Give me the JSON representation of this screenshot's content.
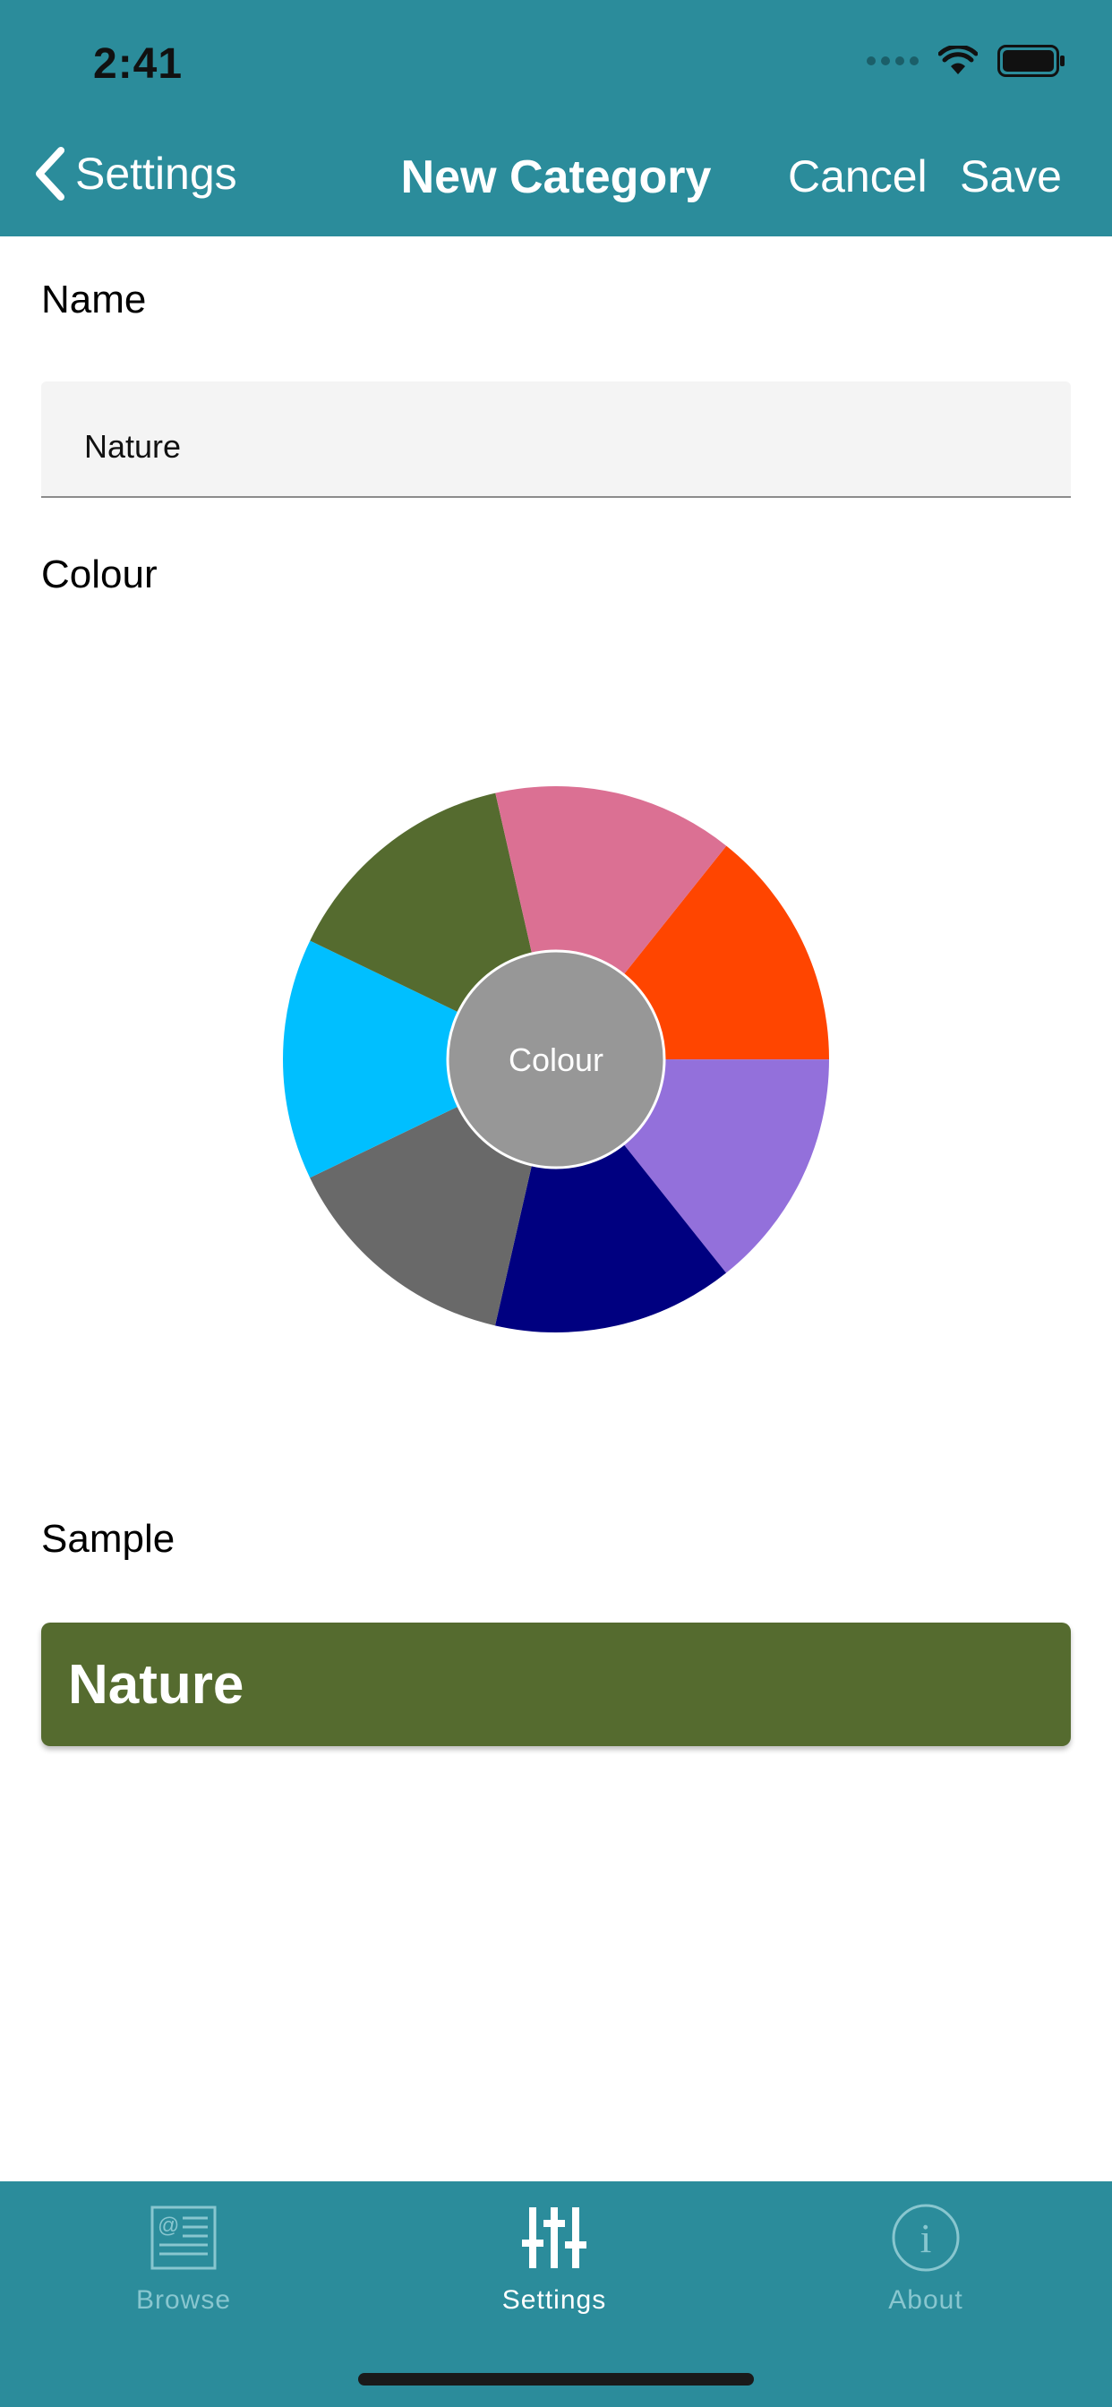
{
  "status_bar": {
    "time": "2:41"
  },
  "nav": {
    "back_label": "Settings",
    "title": "New Category",
    "cancel_label": "Cancel",
    "save_label": "Save"
  },
  "form": {
    "name_label": "Name",
    "name_value": "Nature",
    "colour_label": "Colour",
    "wheel_center_label": "Colour",
    "wheel_colors": [
      "#ff4500",
      "#9370db",
      "#000080",
      "#696969",
      "#00bfff",
      "#556b2f",
      "#db7093"
    ],
    "sample_label": "Sample",
    "sample_text": "Nature",
    "sample_color": "#556b2f"
  },
  "tab_bar": {
    "tabs": [
      {
        "label": "Browse",
        "icon": "browse-icon",
        "active": false
      },
      {
        "label": "Settings",
        "icon": "sliders-icon",
        "active": true
      },
      {
        "label": "About",
        "icon": "info-icon",
        "active": false
      }
    ]
  },
  "colors": {
    "header": "#2b8c9b",
    "accent_inactive": "#88c6cf"
  }
}
